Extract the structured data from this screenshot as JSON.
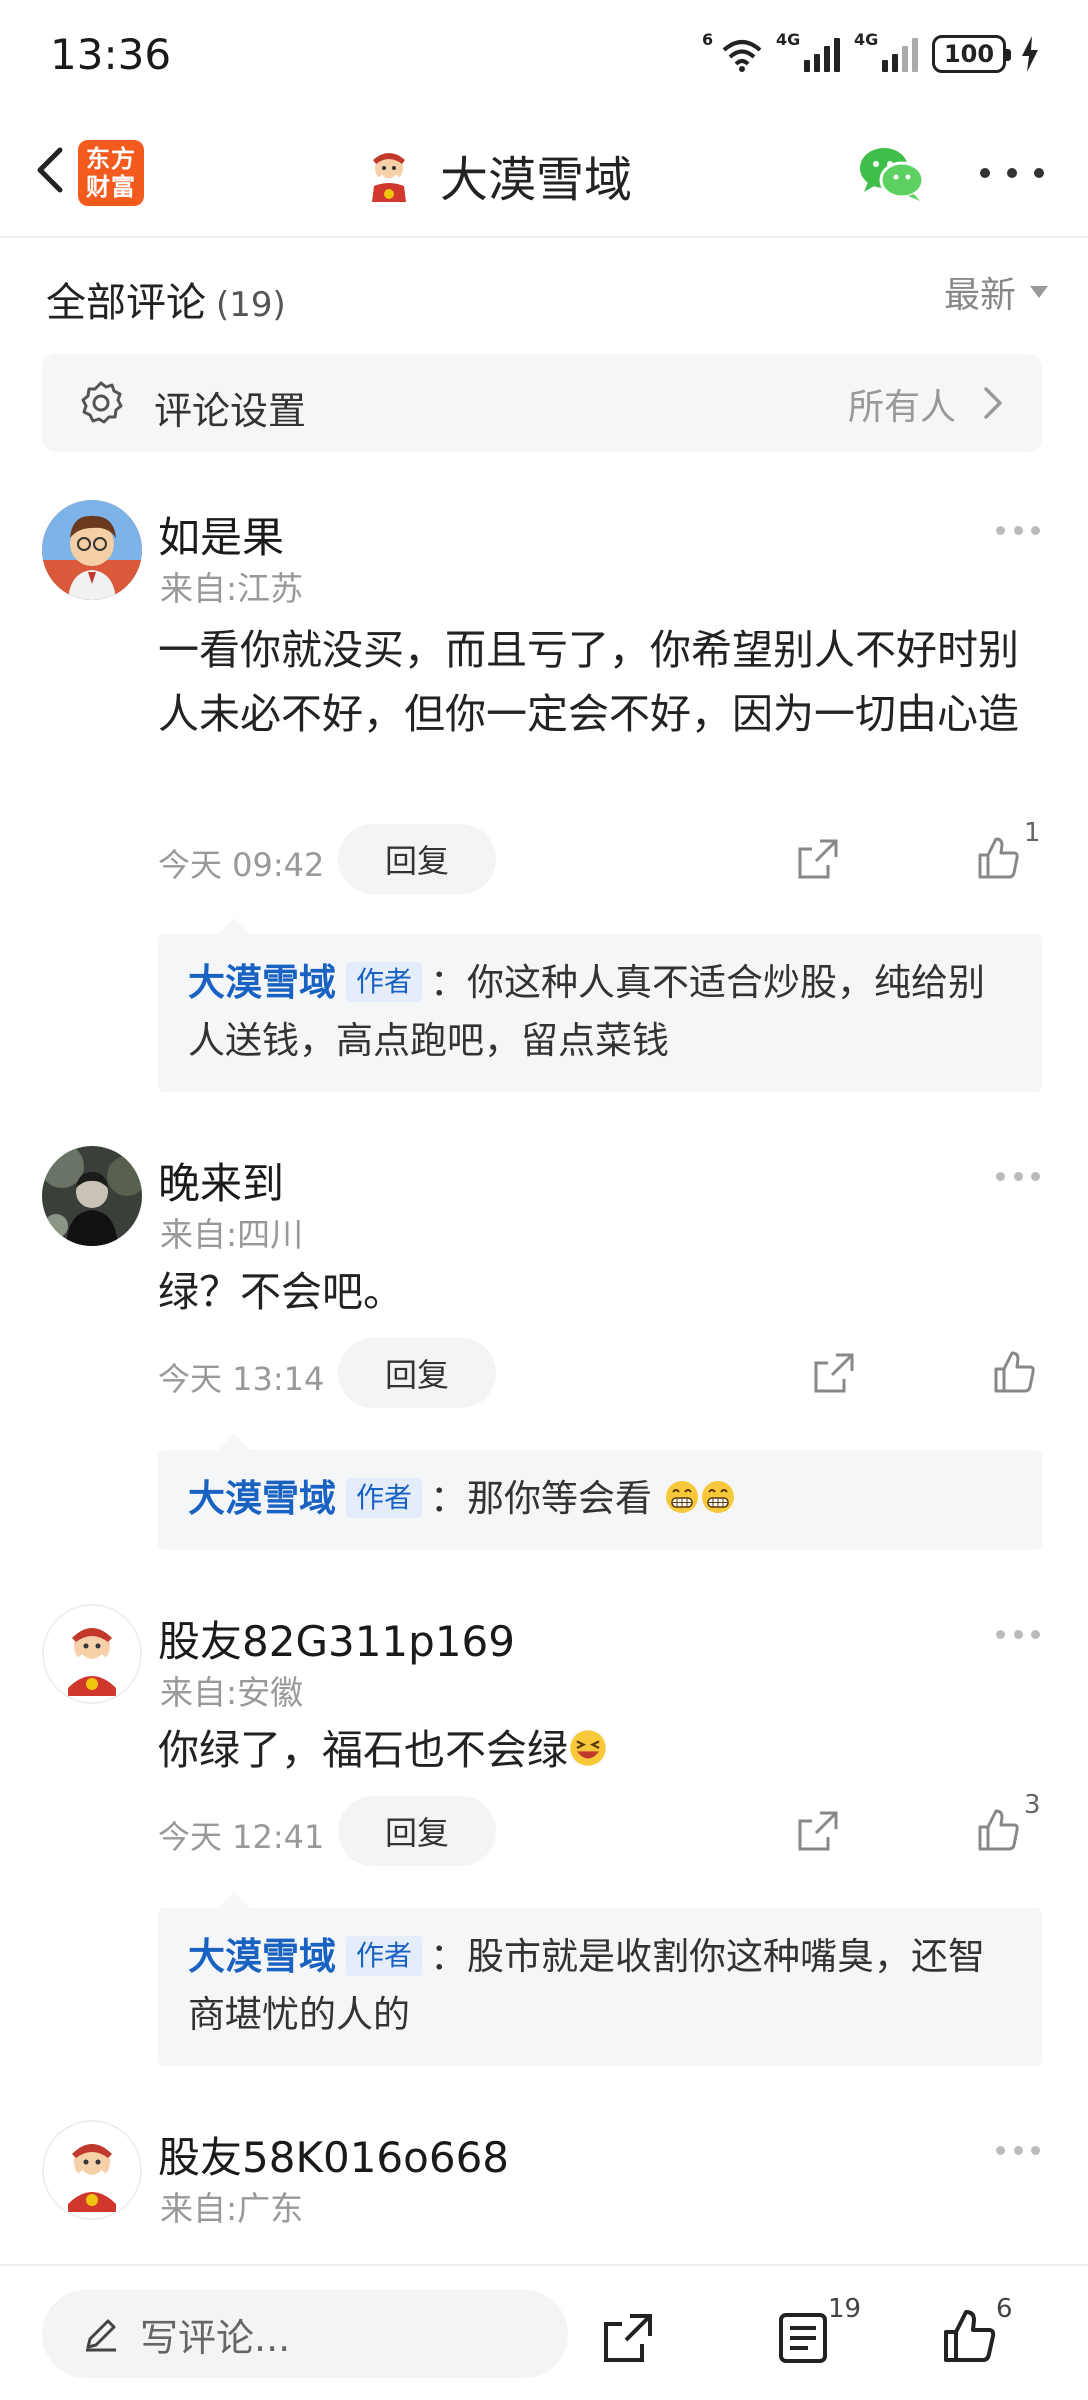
{
  "status_bar": {
    "time": "13:36",
    "signal1_label": "6",
    "signal2_label": "4G",
    "signal3_label": "4G",
    "battery": "100"
  },
  "nav": {
    "logo_line1": "东方",
    "logo_line2": "财富",
    "title": "大漠雪域",
    "icons": [
      "back-icon",
      "wechat-icon",
      "more-icon"
    ]
  },
  "comments_header": {
    "title": "全部评论",
    "count": "(19)",
    "sort": "最新"
  },
  "settings": {
    "label": "评论设置",
    "value": "所有人"
  },
  "comments": [
    {
      "name": "如是果",
      "location": "来自:江苏",
      "body": "一看你就没买，而且亏了，你希望别人不好时别人未必不好，但你一定会不好，因为一切由心造",
      "time": "今天 09:42",
      "reply_label": "回复",
      "likes": "1",
      "author_reply": {
        "author": "大漠雪域",
        "tag": "作者",
        "text": "：你这种人真不适合炒股，纯给别人送钱，高点跑吧，留点菜钱"
      }
    },
    {
      "name": "晚来到",
      "location": "来自:四川",
      "body": "绿？不会吧。",
      "time": "今天 13:14",
      "reply_label": "回复",
      "likes": "",
      "author_reply": {
        "author": "大漠雪域",
        "tag": "作者",
        "text": "：那你等会看"
      }
    },
    {
      "name": "股友82G311p169",
      "location": "来自:安徽",
      "body": "你绿了，福石也不会绿",
      "time": "今天 12:41",
      "reply_label": "回复",
      "likes": "3",
      "author_reply": {
        "author": "大漠雪域",
        "tag": "作者",
        "text": "：股市就是收割你这种嘴臭，还智商堪忧的人的"
      }
    },
    {
      "name": "股友58K016o668",
      "location": "来自:广东"
    }
  ],
  "bottom_bar": {
    "write_placeholder": "写评论...",
    "comments_count": "19",
    "likes_count": "6"
  },
  "colors": {
    "author_blue": "#1a62c2",
    "logo_orange": "#f25a1e",
    "wechat_green": "#3fbf4a"
  }
}
